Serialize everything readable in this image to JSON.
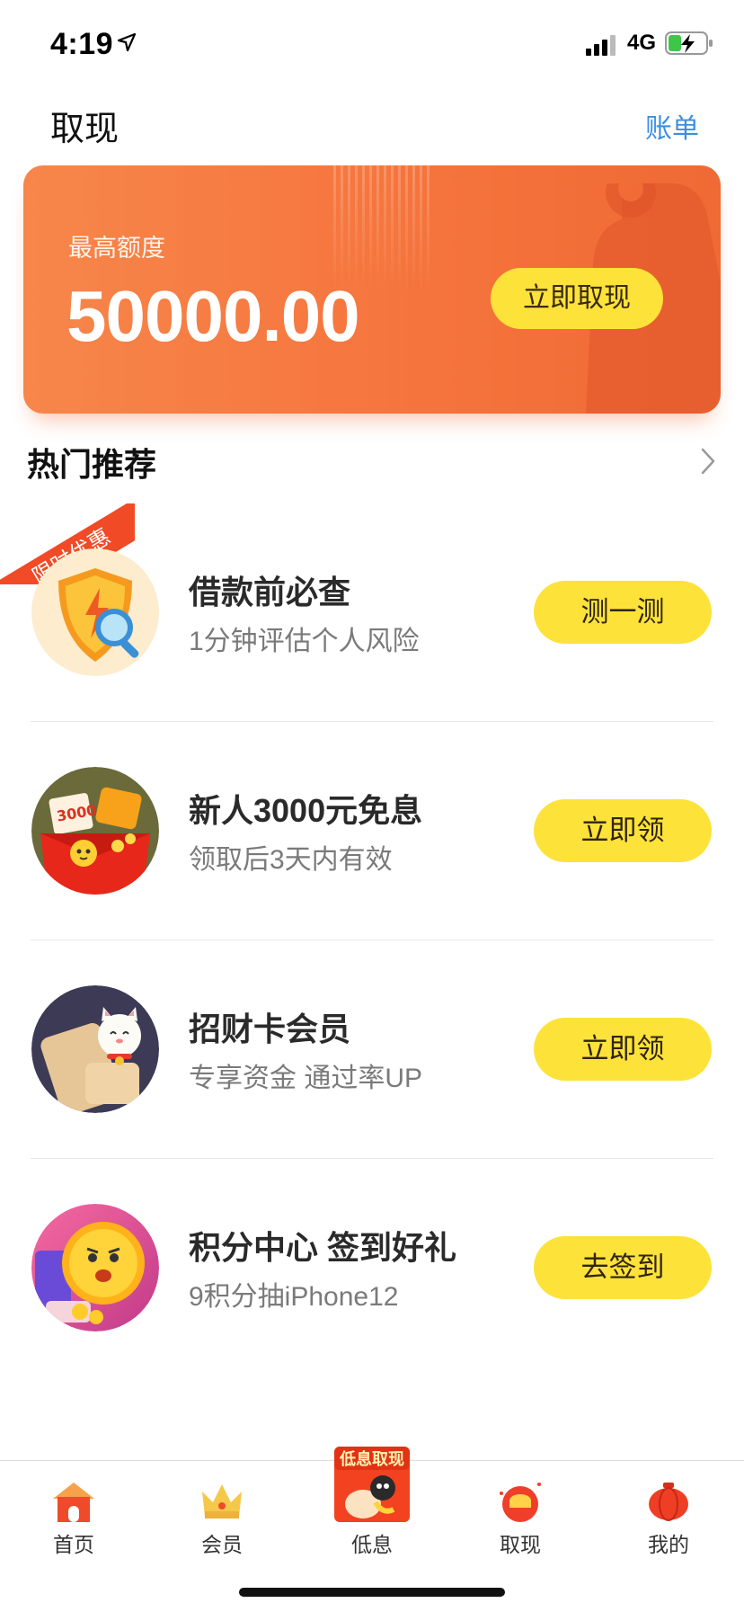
{
  "status_bar": {
    "time": "4:19",
    "network": "4G"
  },
  "header": {
    "title": "取现",
    "bill_link": "账单"
  },
  "credit_card": {
    "limit_label": "最高额度",
    "limit_amount": "50000.00",
    "withdraw_button": "立即取现"
  },
  "recommend": {
    "title": "热门推荐",
    "promo_ribbon": "限时优惠",
    "items": [
      {
        "title": "借款前必查",
        "subtitle": "1分钟评估个人风险",
        "button": "测一测",
        "icon": "shield-magnifier-icon"
      },
      {
        "title": "新人3000元免息",
        "subtitle": "领取后3天内有效",
        "button": "立即领",
        "icon": "gift-box-icon"
      },
      {
        "title": "招财卡会员",
        "subtitle": "专享资金 通过率UP",
        "button": "立即领",
        "icon": "lucky-cat-card-icon"
      },
      {
        "title": "积分中心 签到好礼",
        "subtitle": "9积分抽iPhone12",
        "button": "去签到",
        "icon": "gold-coin-icon"
      }
    ]
  },
  "tab_bar": {
    "center_badge": "低息取现",
    "tabs": [
      {
        "label": "首页",
        "icon": "home-icon"
      },
      {
        "label": "会员",
        "icon": "crown-icon"
      },
      {
        "label": "低息",
        "icon": "low-interest-icon"
      },
      {
        "label": "取现",
        "icon": "cash-icon"
      },
      {
        "label": "我的",
        "icon": "lantern-icon"
      }
    ]
  },
  "colors": {
    "accent_orange": "#f5733c",
    "button_yellow": "#fde23a",
    "link_blue": "#3b8fe0",
    "ribbon_red": "#f04a26"
  }
}
